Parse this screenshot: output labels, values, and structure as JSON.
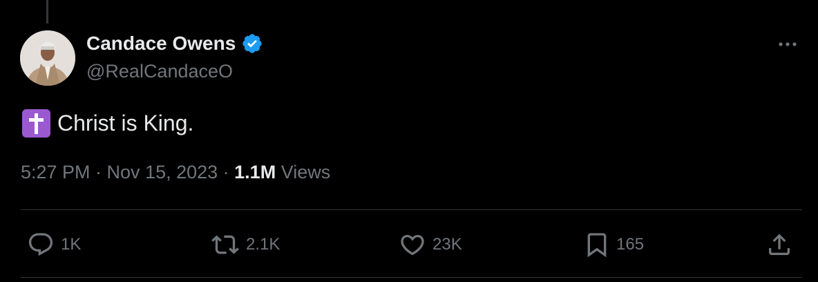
{
  "tweet": {
    "author": {
      "display_name": "Candace Owens",
      "handle": "@RealCandaceO",
      "verified": true,
      "verified_color": "#1d9bf0"
    },
    "text": "Christ is King.",
    "emoji": "latin-cross-emoji",
    "emoji_color": "#9b59d0",
    "timestamp": "5:27 PM · Nov 15, 2023 · ",
    "views_count": "1.1M",
    "views_label": " Views"
  },
  "actions": {
    "replies": "1K",
    "reposts": "2.1K",
    "likes": "23K",
    "bookmarks": "165"
  },
  "colors": {
    "background": "#000000",
    "text_primary": "#e7e9ea",
    "text_secondary": "#71767b",
    "divider": "#2f3336"
  }
}
